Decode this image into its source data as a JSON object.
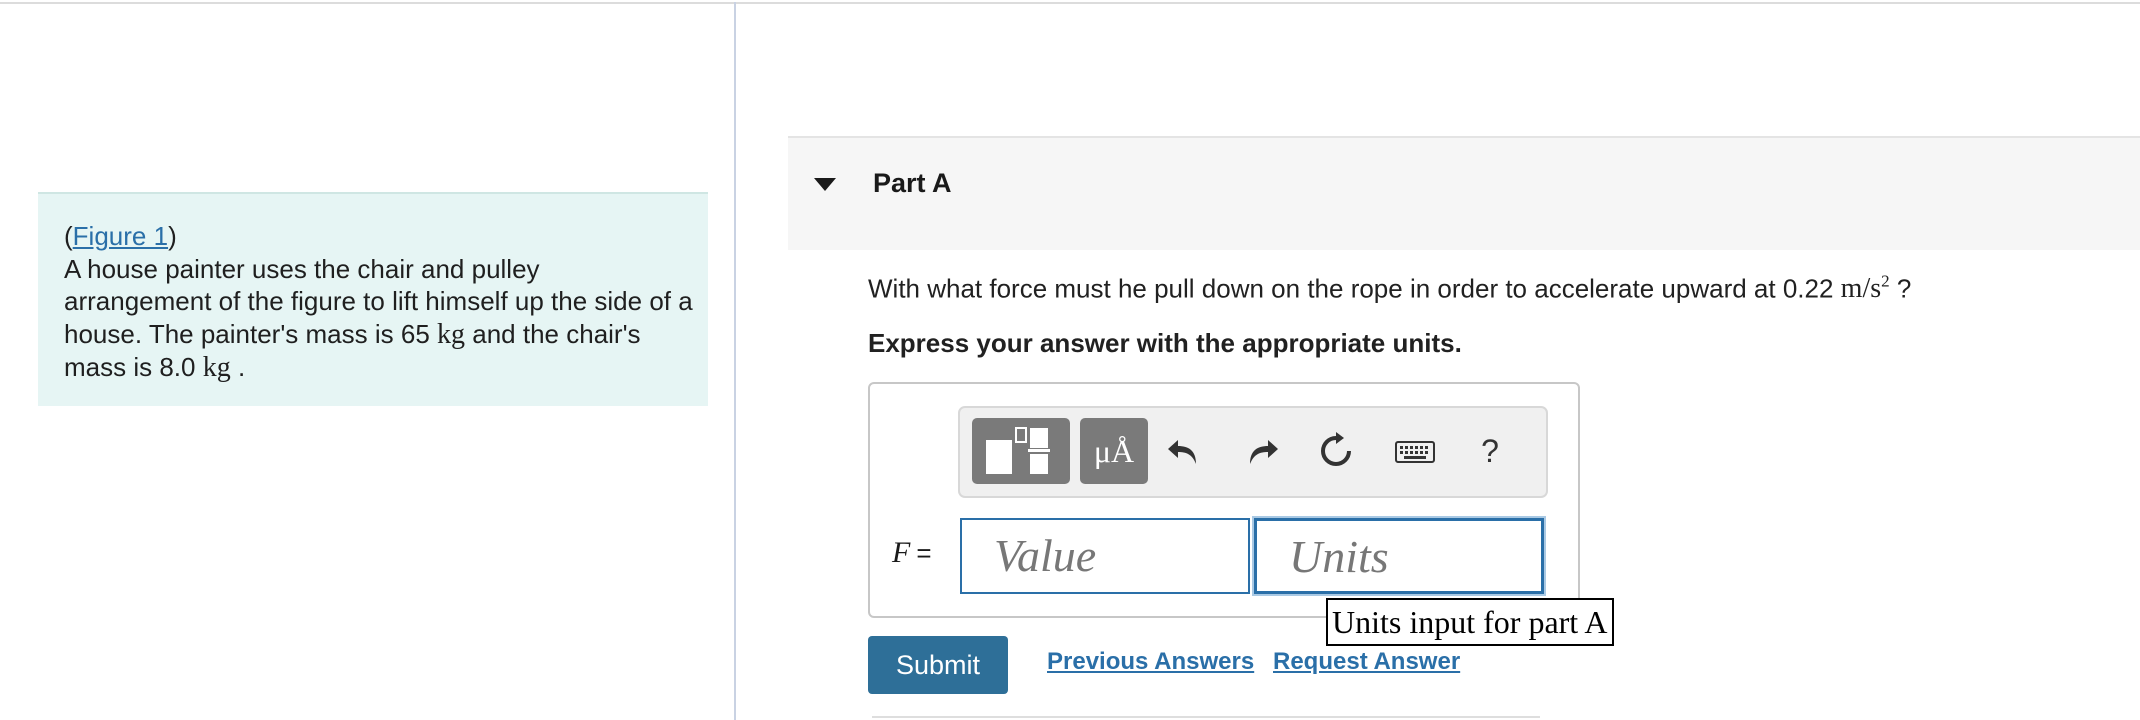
{
  "problem": {
    "figure_link": "Figure 1",
    "text_part1": "A house painter uses the chair and pulley arrangement of the figure to lift himself up the side of a house. The painter's mass is 65",
    "unit_kg_1": "kg",
    "text_part2": "and the chair's mass is 8.0",
    "unit_kg_2": "kg",
    "text_part3": "."
  },
  "part": {
    "title": "Part A",
    "question_prefix": "With what force must he pull down on the rope in order to accelerate upward at 0.22",
    "question_unit": "m/s",
    "question_unit_exp": "2",
    "question_suffix": "?",
    "instruction": "Express your answer with the appropriate units."
  },
  "toolbar": {
    "icons": [
      "templates-icon",
      "mu-angstrom-icon",
      "undo-icon",
      "redo-icon",
      "reset-icon",
      "keyboard-icon",
      "help-icon"
    ],
    "mu_label": "μÅ",
    "help_label": "?"
  },
  "answer": {
    "variable": "F",
    "equals": "=",
    "value_placeholder": "Value",
    "units_placeholder": "Units",
    "tooltip": "Units input for part A"
  },
  "actions": {
    "submit": "Submit",
    "previous_answers": "Previous Answers",
    "request_answer": "Request Answer"
  },
  "colors": {
    "problem_bg": "#e6f5f4",
    "accent": "#2a6fa8",
    "submit_bg": "#2e6f98"
  }
}
